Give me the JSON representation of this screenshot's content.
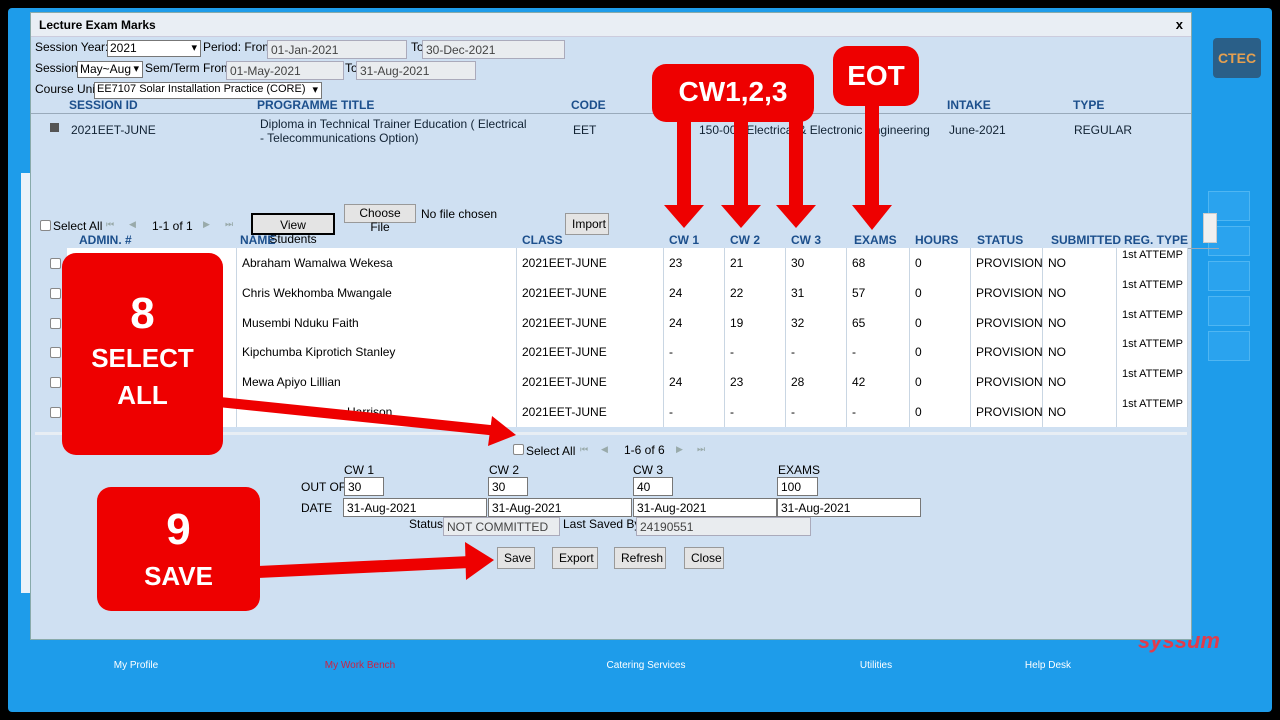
{
  "dialog": {
    "title": "Lecture Exam Marks",
    "close": "x"
  },
  "filters": {
    "session_year_label": "Session Year:*",
    "session_year": "2021",
    "period_from_label": "Period: From",
    "period_from": "01-Jan-2021",
    "to_label": "To",
    "period_to": "30-Dec-2021",
    "session_label": "Session:",
    "session": "May~Aug",
    "sem_from_label": "Sem/Term From:",
    "sem_from": "01-May-2021",
    "sem_to_label": "To",
    "sem_to": "31-Aug-2021",
    "course_unit_label": "Course Unit",
    "course_unit": "EE7107 Solar Installation Practice (CORE)"
  },
  "session_table": {
    "headers": [
      "SESSION ID",
      "PROGRAMME TITLE",
      "CODE",
      "INTAKE",
      "TYPE"
    ],
    "row": {
      "session_id": "2021EET-JUNE",
      "programme_title": "Diploma in Technical Trainer Education ( Electrical - Telecommunications Option)",
      "code": "EET",
      "department": "150-008 Electrical & Electronic Engineering",
      "intake": "June-2021",
      "type": "REGULAR"
    }
  },
  "toolbar": {
    "select_all": "Select All",
    "pager": "1-1 of 1",
    "view_students": "View Students",
    "choose_file": "Choose File",
    "no_file": "No file chosen",
    "import": "Import"
  },
  "students": {
    "headers": [
      "ADMIN. #",
      "NAME",
      "CLASS",
      "CW 1",
      "CW 2",
      "CW 3",
      "EXAMS",
      "HOURS",
      "STATUS",
      "SUBMITTED",
      "REG. TYPE"
    ],
    "rows": [
      {
        "name": "Abraham Wamalwa Wekesa",
        "class": "2021EET-JUNE",
        "cw1": "23",
        "cw2": "21",
        "cw3": "30",
        "exams": "68",
        "hours": "0",
        "status": "PROVISION",
        "submitted": "NO",
        "reg": "1st ATTEMP"
      },
      {
        "name": "Chris Wekhomba Mwangale",
        "class": "2021EET-JUNE",
        "cw1": "24",
        "cw2": "22",
        "cw3": "31",
        "exams": "57",
        "hours": "0",
        "status": "PROVISION",
        "submitted": "NO",
        "reg": "1st ATTEMP"
      },
      {
        "name": "Musembi Nduku Faith",
        "class": "2021EET-JUNE",
        "cw1": "24",
        "cw2": "19",
        "cw3": "32",
        "exams": "65",
        "hours": "0",
        "status": "PROVISION",
        "submitted": "NO",
        "reg": "1st ATTEMP"
      },
      {
        "name": "Kipchumba Kiprotich Stanley",
        "class": "2021EET-JUNE",
        "cw1": "-",
        "cw2": "-",
        "cw3": "-",
        "exams": "-",
        "hours": "0",
        "status": "PROVISION",
        "submitted": "NO",
        "reg": "1st ATTEMP"
      },
      {
        "name": "Mewa Apiyo Lillian",
        "class": "2021EET-JUNE",
        "cw1": "24",
        "cw2": "23",
        "cw3": "28",
        "exams": "42",
        "hours": "0",
        "status": "PROVISION",
        "submitted": "NO",
        "reg": "1st ATTEMP"
      },
      {
        "name": "Harrison",
        "class": "2021EET-JUNE",
        "cw1": "-",
        "cw2": "-",
        "cw3": "-",
        "exams": "-",
        "hours": "0",
        "status": "PROVISION",
        "submitted": "NO",
        "reg": "1st ATTEMP"
      }
    ]
  },
  "footer": {
    "select_all": "Select All",
    "pager": "1-6 of 6",
    "cw1_label": "CW 1",
    "cw2_label": "CW 2",
    "cw3_label": "CW 3",
    "exams_label": "EXAMS",
    "out_of_label": "OUT OF",
    "date_label": "DATE",
    "cw1_out": "30",
    "cw2_out": "30",
    "cw3_out": "40",
    "exams_out": "100",
    "cw1_date": "31-Aug-2021",
    "cw2_date": "31-Aug-2021",
    "cw3_date": "31-Aug-2021",
    "exams_date": "31-Aug-2021",
    "status_label": "Status:",
    "status": "NOT COMMITTED",
    "last_saved_label": "Last Saved By:",
    "last_saved": "24190551",
    "save": "Save",
    "export": "Export",
    "refresh": "Refresh",
    "close": "Close"
  },
  "bottom_nav": [
    "My Profile",
    "My Work Bench",
    "Catering Services",
    "Utilities",
    "Help Desk"
  ],
  "callouts": {
    "cw": "CW1,2,3",
    "eot": "EOT",
    "step8_num": "8",
    "step8_text1": "SELECT",
    "step8_text2": "ALL",
    "step9_num": "9",
    "step9_text": "SAVE"
  },
  "colors": {
    "callout": "#ee0000",
    "background": "#1e9cea",
    "dialog": "#cfe0f2",
    "header_text": "#1c4f8c"
  }
}
